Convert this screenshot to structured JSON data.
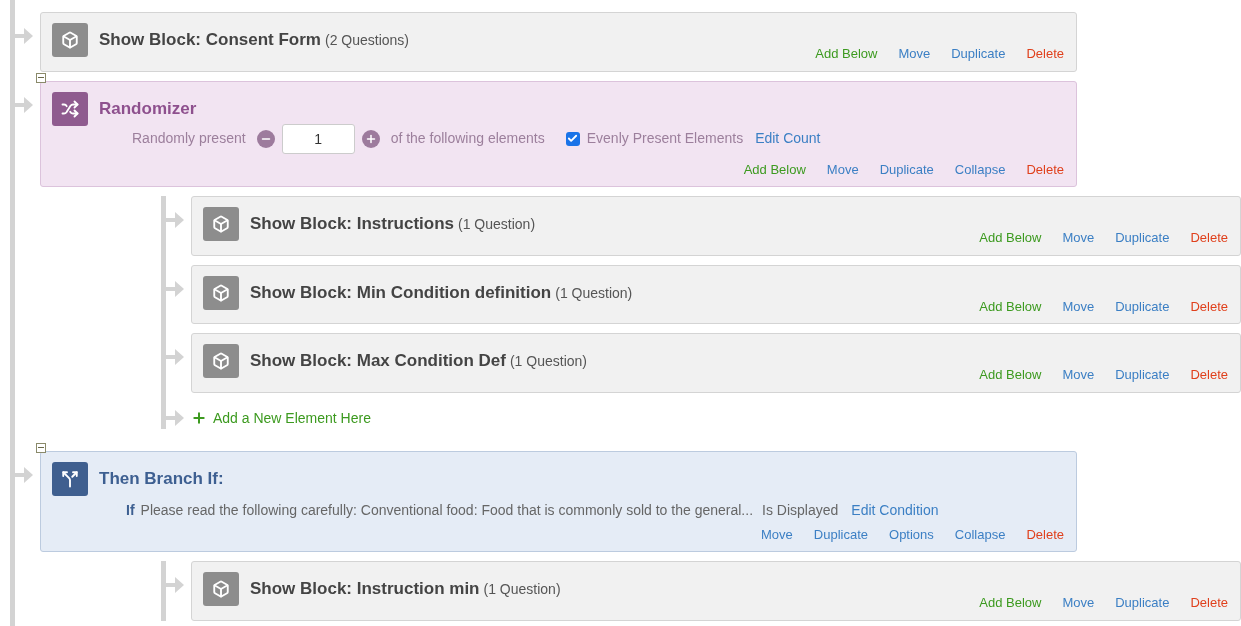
{
  "flow": [
    {
      "kind": "block",
      "title": "Show Block: Consent Form",
      "count": "(2 Questions)",
      "actions": [
        {
          "kind": "add",
          "label": "Add Below"
        },
        {
          "kind": "move",
          "label": "Move"
        },
        {
          "kind": "duplicate",
          "label": "Duplicate"
        },
        {
          "kind": "delete",
          "label": "Delete"
        }
      ]
    },
    {
      "kind": "randomizer",
      "expanded": true,
      "title": "Randomizer",
      "settings": {
        "label_before": "Randomly present",
        "value": "1",
        "label_after": "of the following elements",
        "evenly_checked": true,
        "evenly_label": "Evenly Present Elements",
        "edit_link": "Edit Count"
      },
      "actions": [
        {
          "kind": "add",
          "label": "Add Below"
        },
        {
          "kind": "move",
          "label": "Move"
        },
        {
          "kind": "duplicate",
          "label": "Duplicate"
        },
        {
          "kind": "collapse",
          "label": "Collapse"
        },
        {
          "kind": "delete",
          "label": "Delete"
        }
      ],
      "children": [
        {
          "kind": "block",
          "title": "Show Block: Instructions",
          "count": "(1 Question)",
          "actions": [
            {
              "kind": "add",
              "label": "Add Below"
            },
            {
              "kind": "move",
              "label": "Move"
            },
            {
              "kind": "duplicate",
              "label": "Duplicate"
            },
            {
              "kind": "delete",
              "label": "Delete"
            }
          ]
        },
        {
          "kind": "block",
          "title": "Show Block: Min Condition definition",
          "count": "(1 Question)",
          "actions": [
            {
              "kind": "add",
              "label": "Add Below"
            },
            {
              "kind": "move",
              "label": "Move"
            },
            {
              "kind": "duplicate",
              "label": "Duplicate"
            },
            {
              "kind": "delete",
              "label": "Delete"
            }
          ]
        },
        {
          "kind": "block",
          "title": "Show Block: Max Condition Def",
          "count": "(1 Question)",
          "actions": [
            {
              "kind": "add",
              "label": "Add Below"
            },
            {
              "kind": "move",
              "label": "Move"
            },
            {
              "kind": "duplicate",
              "label": "Duplicate"
            },
            {
              "kind": "delete",
              "label": "Delete"
            }
          ]
        }
      ],
      "add_element": "Add a New Element Here"
    },
    {
      "kind": "branch",
      "expanded": true,
      "title": "Then Branch If:",
      "condition": {
        "keyword": "If",
        "text": "Please read the following carefully: Conventional food: Food that is commonly sold to the general...",
        "operator": "Is Displayed",
        "edit_link": "Edit Condition"
      },
      "actions": [
        {
          "kind": "move",
          "label": "Move"
        },
        {
          "kind": "duplicate",
          "label": "Duplicate"
        },
        {
          "kind": "options",
          "label": "Options"
        },
        {
          "kind": "collapse",
          "label": "Collapse"
        },
        {
          "kind": "delete",
          "label": "Delete"
        }
      ],
      "children": [
        {
          "kind": "block",
          "title": "Show Block: Instruction min",
          "count": "(1 Question)",
          "actions": [
            {
              "kind": "add",
              "label": "Add Below"
            },
            {
              "kind": "move",
              "label": "Move"
            },
            {
              "kind": "duplicate",
              "label": "Duplicate"
            },
            {
              "kind": "delete",
              "label": "Delete"
            }
          ]
        }
      ]
    }
  ]
}
